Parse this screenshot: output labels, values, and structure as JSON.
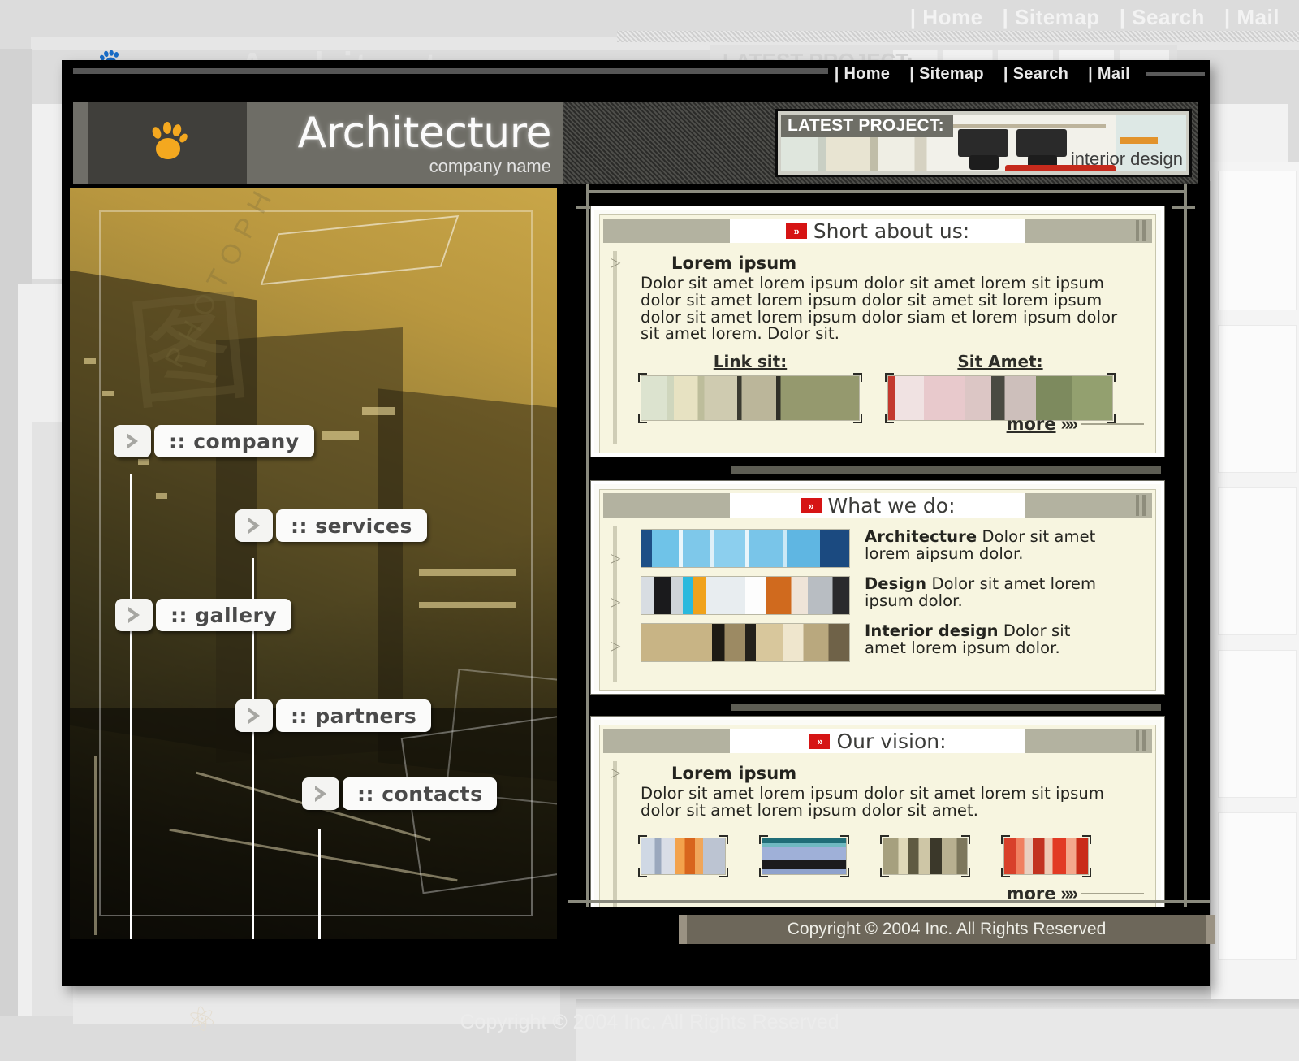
{
  "top_nav": {
    "items": [
      "| Home",
      "| Sitemap",
      "| Search",
      "| Mail"
    ]
  },
  "header": {
    "logo_icon": "paw-icon",
    "title": "Architecture",
    "subtitle": "company name",
    "latest_project_label": "LATEST PROJECT:",
    "latest_project_caption": "interior design"
  },
  "side_menu": {
    "items": [
      {
        "label": ":: company"
      },
      {
        "label": ":: services"
      },
      {
        "label": ":: gallery"
      },
      {
        "label": ":: partners"
      },
      {
        "label": ":: contacts"
      }
    ]
  },
  "sections": {
    "about": {
      "badge": "»",
      "title": "Short about us:",
      "heading": "Lorem ipsum",
      "paragraph": "Dolor sit amet lorem ipsum dolor sit amet lorem sit ipsum dolor sit amet lorem ipsum dolor sit amet sit lorem ipsum dolor sit amet lorem ipsum dolor siam et lorem ipsum dolor sit amet lorem. Dolor sit.",
      "link_left": "Link sit:",
      "link_right": "Sit Amet:",
      "more": "more",
      "more_chevrons": "»»"
    },
    "what_we_do": {
      "badge": "»",
      "title": "What we do:",
      "items": [
        {
          "name": "Architecture",
          "text": "Dolor sit amet lorem  aipsum dolor."
        },
        {
          "name": "Design",
          "text": "Dolor sit amet lorem ipsum dolor."
        },
        {
          "name": "Interior design",
          "text": "Dolor sit amet lorem ipsum dolor."
        }
      ]
    },
    "vision": {
      "badge": "»",
      "title": "Our vision:",
      "heading": "Lorem ipsum",
      "paragraph": "Dolor sit amet lorem ipsum dolor sit amet lorem sit ipsum dolor sit amet lorem ipsum dolor sit amet.",
      "more": "more",
      "more_chevrons": "»»"
    }
  },
  "footer": {
    "copyright": "Copyright © 2004 Inc. All Rights Reserved"
  },
  "background_ghost": {
    "nav_items": [
      "| Home",
      "| Sitemap",
      "| Search",
      "| Mail"
    ],
    "title": "Architecture",
    "latest_project_label": "LATEST PROJECT:",
    "copyright": "Copyright © 2004 Inc. All Rights Reserved"
  },
  "colors": {
    "accent_red": "#d61414",
    "logo_gold": "#f4a81f",
    "panel_cream": "#f7f5e0",
    "header_grey": "#6e6d66"
  }
}
